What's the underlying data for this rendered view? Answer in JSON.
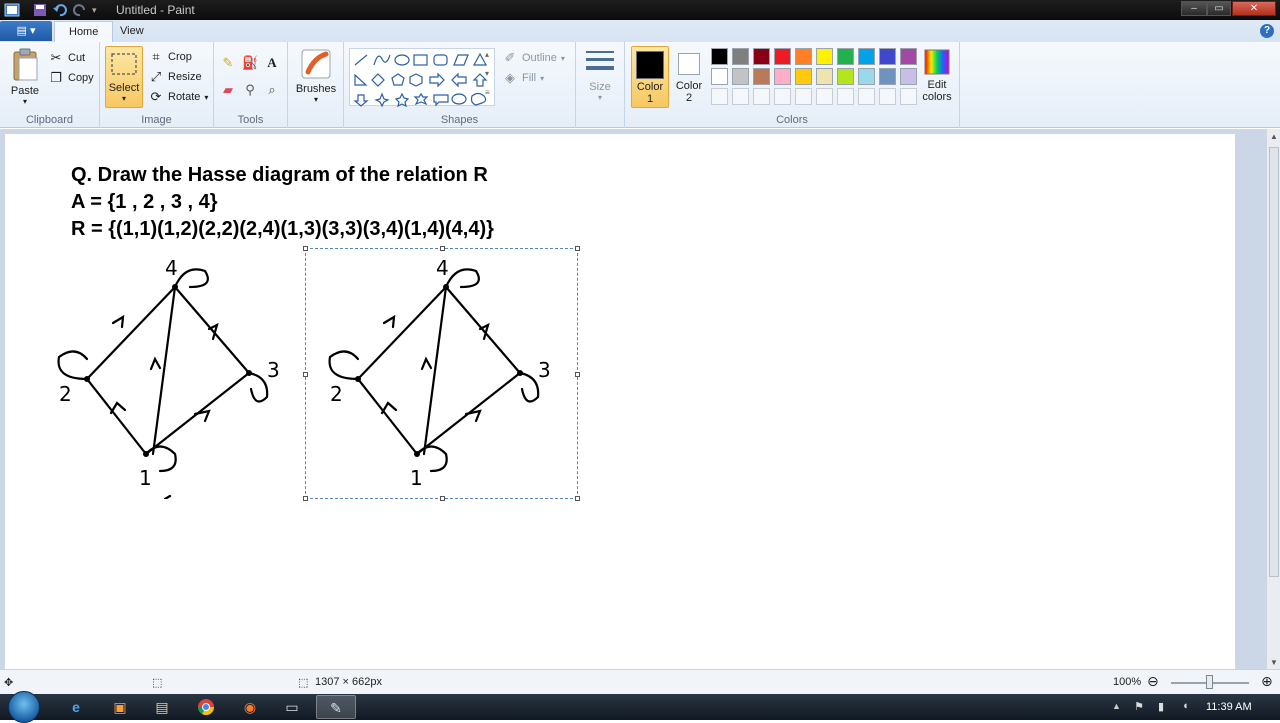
{
  "window": {
    "title": "Untitled - Paint"
  },
  "tabs": [
    {
      "label": "Home",
      "active": true
    },
    {
      "label": "View",
      "active": false
    }
  ],
  "ribbon": {
    "clipboard": {
      "label": "Clipboard",
      "paste": "Paste",
      "cut": "Cut",
      "copy": "Copy"
    },
    "image": {
      "label": "Image",
      "select": "Select",
      "crop": "Crop",
      "resize": "Resize",
      "rotate": "Rotate"
    },
    "tools": {
      "label": "Tools"
    },
    "brushes": {
      "label": "Brushes"
    },
    "shapes": {
      "label": "Shapes",
      "outline": "Outline",
      "fill": "Fill"
    },
    "size": {
      "label": "Size"
    },
    "colors": {
      "label": "Colors",
      "color1": [
        "Color",
        "1"
      ],
      "color2": [
        "Color",
        "2"
      ],
      "edit": [
        "Edit",
        "colors"
      ],
      "color1_value": "#000000",
      "color2_value": "#ffffff",
      "palette_row1": [
        "#000000",
        "#7f7f7f",
        "#880015",
        "#ed1c24",
        "#ff7f27",
        "#fff200",
        "#22b14c",
        "#00a2e8",
        "#3f48cc",
        "#a349a4"
      ],
      "palette_row2": [
        "#ffffff",
        "#c3c3c3",
        "#b97a57",
        "#ffaec9",
        "#ffc90e",
        "#efe4b0",
        "#b5e61d",
        "#99d9ea",
        "#7092be",
        "#c8bfe7"
      ]
    }
  },
  "canvas": {
    "question": "Q. Draw the Hasse diagram of the relation R",
    "set_a": "A = {1 , 2 , 3 , 4}",
    "relation": "R = {(1,1)(1,2)(2,2)(2,4)(1,3)(3,3)(3,4)(1,4)(4,4)}",
    "diagram_labels": [
      "4",
      "2",
      "3",
      "1"
    ]
  },
  "statusbar": {
    "size": "1307 × 662px",
    "zoom": "100%"
  },
  "taskbar": {
    "time": "11:39 AM"
  }
}
